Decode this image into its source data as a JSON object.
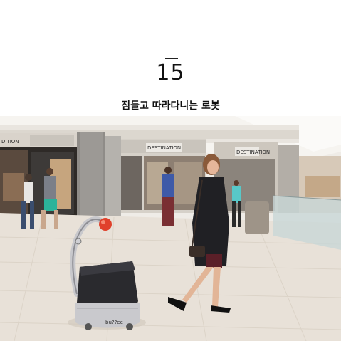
{
  "header": {
    "number": "15",
    "title": "짐들고 따라다니는 로봇"
  },
  "photo": {
    "robot_brand": "bu??ee",
    "store_signs": [
      "DITION",
      "DESTINATION",
      "DESTINATION"
    ]
  },
  "colors": {
    "robot_ball": "#e0412b",
    "robot_bag": "#2a2a2e",
    "floor": "#e8e1d8",
    "wall": "#f2efea"
  }
}
